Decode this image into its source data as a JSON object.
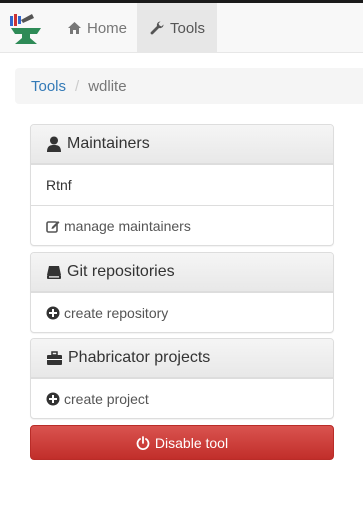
{
  "navbar": {
    "logo_icon": "toolforge-anvil-logo",
    "items": [
      {
        "label": "Home",
        "icon": "home-icon"
      },
      {
        "label": "Tools",
        "icon": "wrench-icon",
        "active": true
      }
    ]
  },
  "breadcrumb": {
    "items": [
      {
        "label": "Tools",
        "link": true
      },
      {
        "label": "wdlite",
        "link": false
      }
    ]
  },
  "maintainers": {
    "title": "Maintainers",
    "icon": "user-icon",
    "users": [
      "Rtnf"
    ],
    "manage_label": "manage maintainers"
  },
  "git": {
    "title": "Git repositories",
    "icon": "hdd-icon",
    "action_label": "create repository"
  },
  "phabricator": {
    "title": "Phabricator projects",
    "icon": "briefcase-icon",
    "action_label": "create project"
  },
  "disable_button": {
    "label": "Disable tool",
    "icon": "power-icon",
    "color": "#d9534f"
  },
  "colors": {
    "link": "#337ab7",
    "danger": "#d9534f",
    "navbar_bg": "#f8f8f8",
    "panel_heading_bg": "#f0f0f0"
  }
}
